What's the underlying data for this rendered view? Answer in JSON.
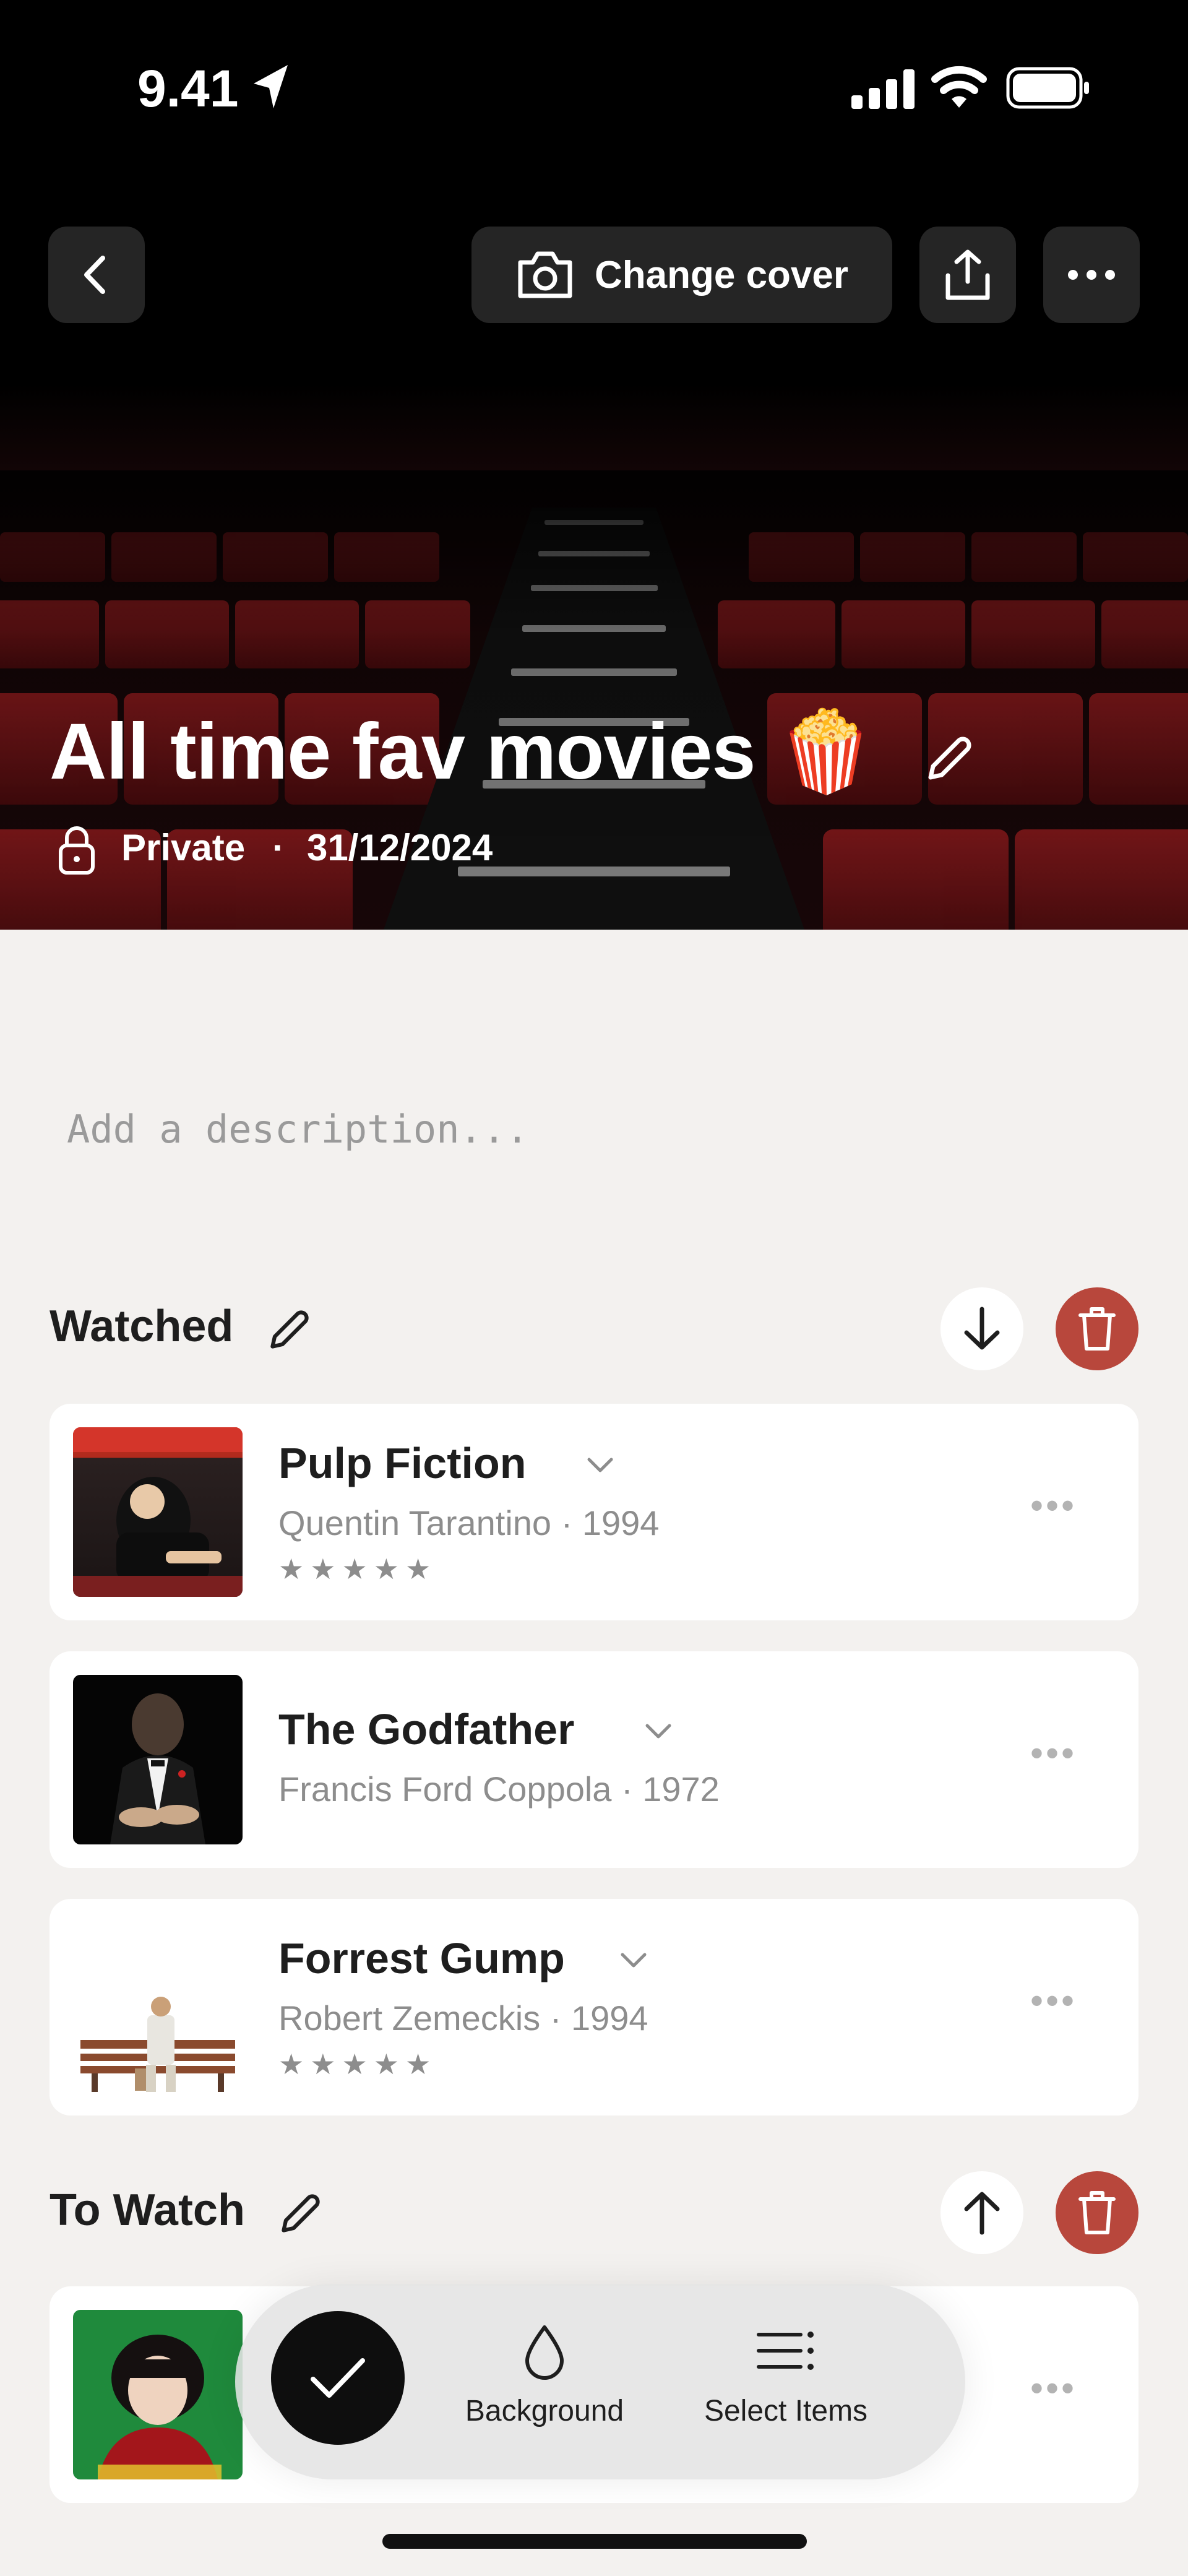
{
  "status_bar": {
    "time": "9.41"
  },
  "hero": {
    "change_cover_label": "Change cover",
    "title": "All time fav movies 🍿",
    "privacy": "Private",
    "separator": "·",
    "date": "31/12/2024"
  },
  "description": {
    "placeholder": "Add a description..."
  },
  "sections": [
    {
      "title": "Watched",
      "items": [
        {
          "title": "Pulp Fiction",
          "director": "Quentin Tarantino",
          "year": "1994",
          "meta": "Quentin Tarantino · 1994",
          "rating": 5
        },
        {
          "title": "The Godfather",
          "director": "Francis Ford Coppola",
          "year": "1972",
          "meta": "Francis Ford Coppola · 1972",
          "rating": 0
        },
        {
          "title": "Forrest Gump",
          "director": "Robert Zemeckis",
          "year": "1994",
          "meta": "Robert Zemeckis · 1994",
          "rating": 5
        }
      ]
    },
    {
      "title": "To Watch",
      "items": [
        {
          "title": "",
          "rating": 0
        }
      ]
    }
  ],
  "toolbar": {
    "background_label": "Background",
    "select_label": "Select Items"
  },
  "colors": {
    "delete_red": "#b8473c",
    "hero_seat_red": "#7a1416",
    "page_bg": "#f3f1ef"
  }
}
